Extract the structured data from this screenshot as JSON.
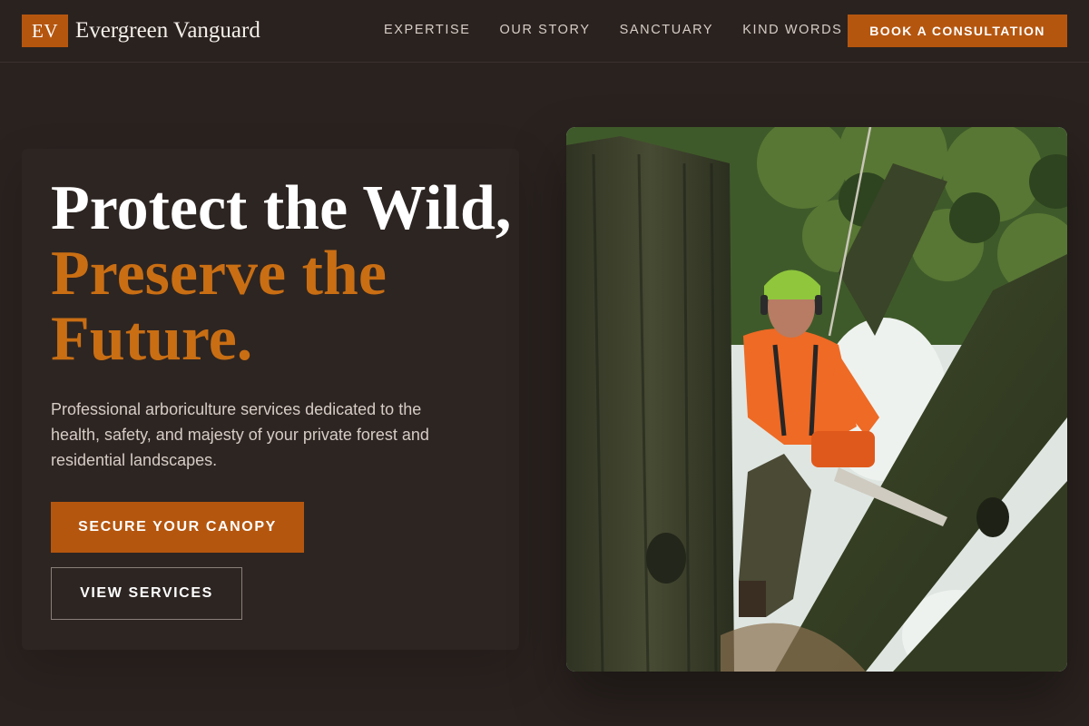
{
  "brand": {
    "initials": "EV",
    "name": "Evergreen Vanguard"
  },
  "nav": {
    "items": [
      "EXPERTISE",
      "OUR STORY",
      "SANCTUARY",
      "KIND WORDS"
    ],
    "cta_label": "BOOK A CONSULTATION"
  },
  "hero": {
    "headline_line1": "Protect the Wild,",
    "headline_line2": "Preserve the",
    "headline_line3": "Future.",
    "subtext": "Professional arboriculture services dedicated to the health, safety, and majesty of your private forest and residential landscapes.",
    "primary_button": "SECURE YOUR CANOPY",
    "secondary_button": "VIEW SERVICES"
  },
  "image": {
    "subject": "arborist-in-tree-with-chainsaw"
  },
  "colors": {
    "background": "#2a221f",
    "accent": "#b5560f",
    "accent_text": "#c96e13",
    "text_primary": "#ffffff",
    "text_secondary": "#d6ccc5"
  }
}
